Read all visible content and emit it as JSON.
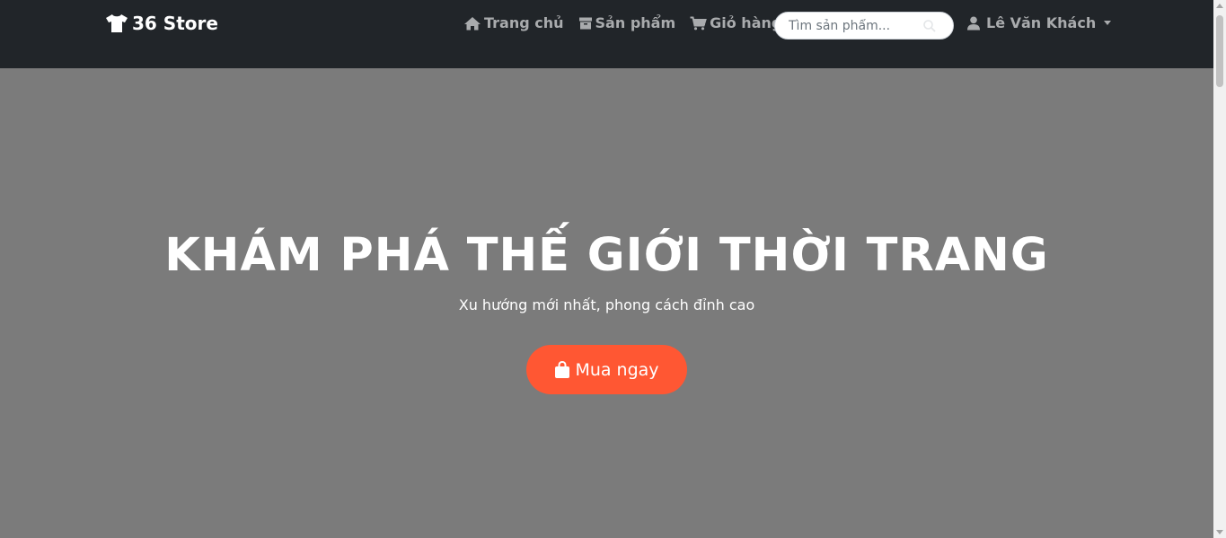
{
  "navbar": {
    "brand": {
      "label": "36 Store",
      "icon": "tshirt-icon"
    },
    "links": [
      {
        "label": "Trang chủ",
        "icon": "home-icon"
      },
      {
        "label": "Sản phẩm",
        "icon": "box-icon"
      },
      {
        "label": "Giỏ hàng",
        "icon": "cart-icon"
      }
    ],
    "search": {
      "placeholder": "Tìm sản phẩm...",
      "value": "",
      "icon": "search-icon"
    },
    "user": {
      "name": "Lê Văn Khách",
      "icon": "user-icon"
    }
  },
  "hero": {
    "title": "KHÁM PHÁ THẾ GIỚI THỜI TRANG",
    "subtitle": "Xu hướng mới nhất, phong cách đỉnh cao",
    "cta_label": "Mua ngay",
    "cta_icon": "shopping-bag-icon"
  },
  "colors": {
    "navbar_bg": "#212529",
    "hero_bg": "#7b7b7b",
    "accent": "#ff5733",
    "nav_text": "#a9abad"
  }
}
